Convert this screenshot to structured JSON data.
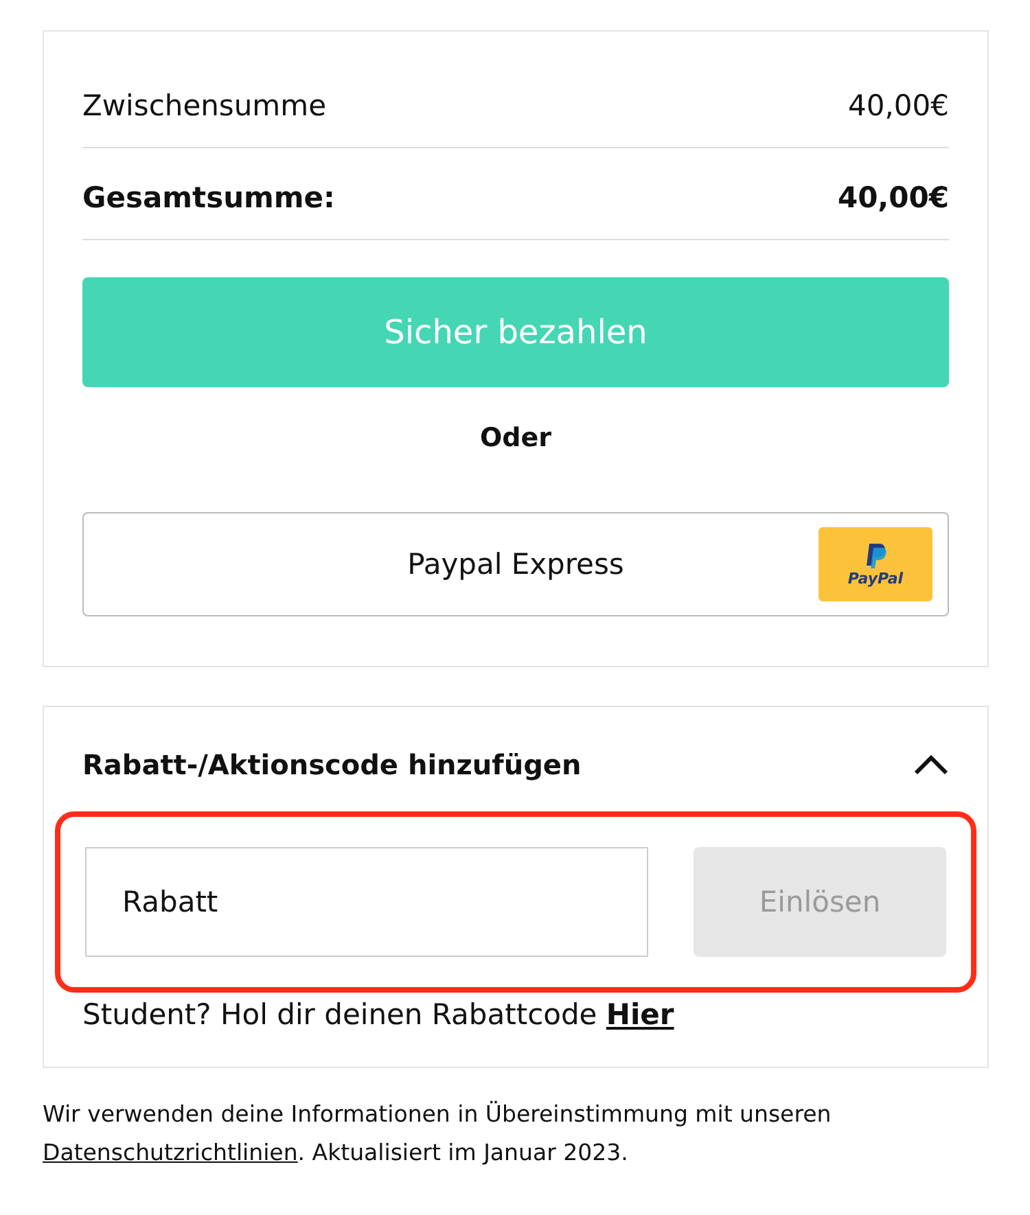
{
  "summary": {
    "subtotal": {
      "label": "Zwischensumme",
      "value": "40,00€"
    },
    "total": {
      "label": "Gesamtsumme:",
      "value": "40,00€"
    },
    "pay_button": "Sicher bezahlen",
    "separator": "Oder",
    "paypal_button": {
      "label": "Paypal Express",
      "logo_text": "PayPal"
    }
  },
  "promo": {
    "title": "Rabatt-/Aktionscode hinzufügen",
    "expanded": true,
    "highlighted": true,
    "code_field": {
      "value": "Rabatt"
    },
    "redeem_button": {
      "label": "Einlösen",
      "disabled": true
    },
    "student_text": "Student? Hol dir deinen Rabattcode",
    "student_link": "Hier"
  },
  "footer": {
    "text": "Wir verwenden deine Informationen in Übereinstimmung mit unseren",
    "link": "Datenschutzrichtlinien",
    "suffix": ". Aktualisiert im Januar 2023."
  }
}
